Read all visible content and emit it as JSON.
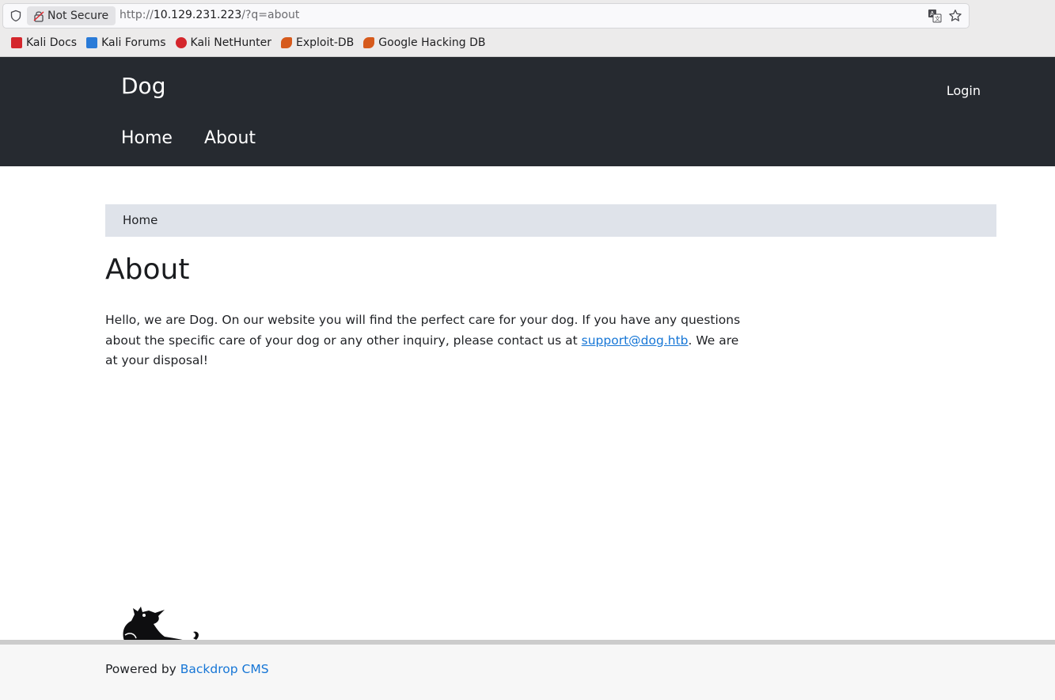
{
  "browser": {
    "security_label": "Not Secure",
    "url_scheme": "http://",
    "url_host": "10.129.231.223",
    "url_path": "/?q=about",
    "bookmarks": [
      {
        "label": "Kali Docs",
        "icon": "kali-docs-icon",
        "color": "#d4262c"
      },
      {
        "label": "Kali Forums",
        "icon": "kali-forums-icon",
        "color": "#2a7bd8"
      },
      {
        "label": "Kali NetHunter",
        "icon": "kali-nethunter-icon",
        "color": "#d4262c"
      },
      {
        "label": "Exploit-DB",
        "icon": "exploit-db-icon",
        "color": "#d65a1c"
      },
      {
        "label": "Google Hacking DB",
        "icon": "ghdb-icon",
        "color": "#d65a1c"
      }
    ]
  },
  "site": {
    "name": "Dog",
    "login_label": "Login",
    "menu": [
      {
        "label": "Home"
      },
      {
        "label": "About"
      }
    ],
    "header_color": "#262a30"
  },
  "breadcrumb": {
    "home_label": "Home"
  },
  "page": {
    "title": "About",
    "text_before_link": "Hello, we are Dog. On our website you will find the perfect care for your dog. If you have any questions about the specific care of your dog or any other inquiry, please contact us at ",
    "email_link": "support@dog.htb",
    "text_after_link": ". We are at your disposal!"
  },
  "footer": {
    "powered_prefix": "Powered by ",
    "cms_link": "Backdrop CMS",
    "link_color": "#1676d6"
  }
}
